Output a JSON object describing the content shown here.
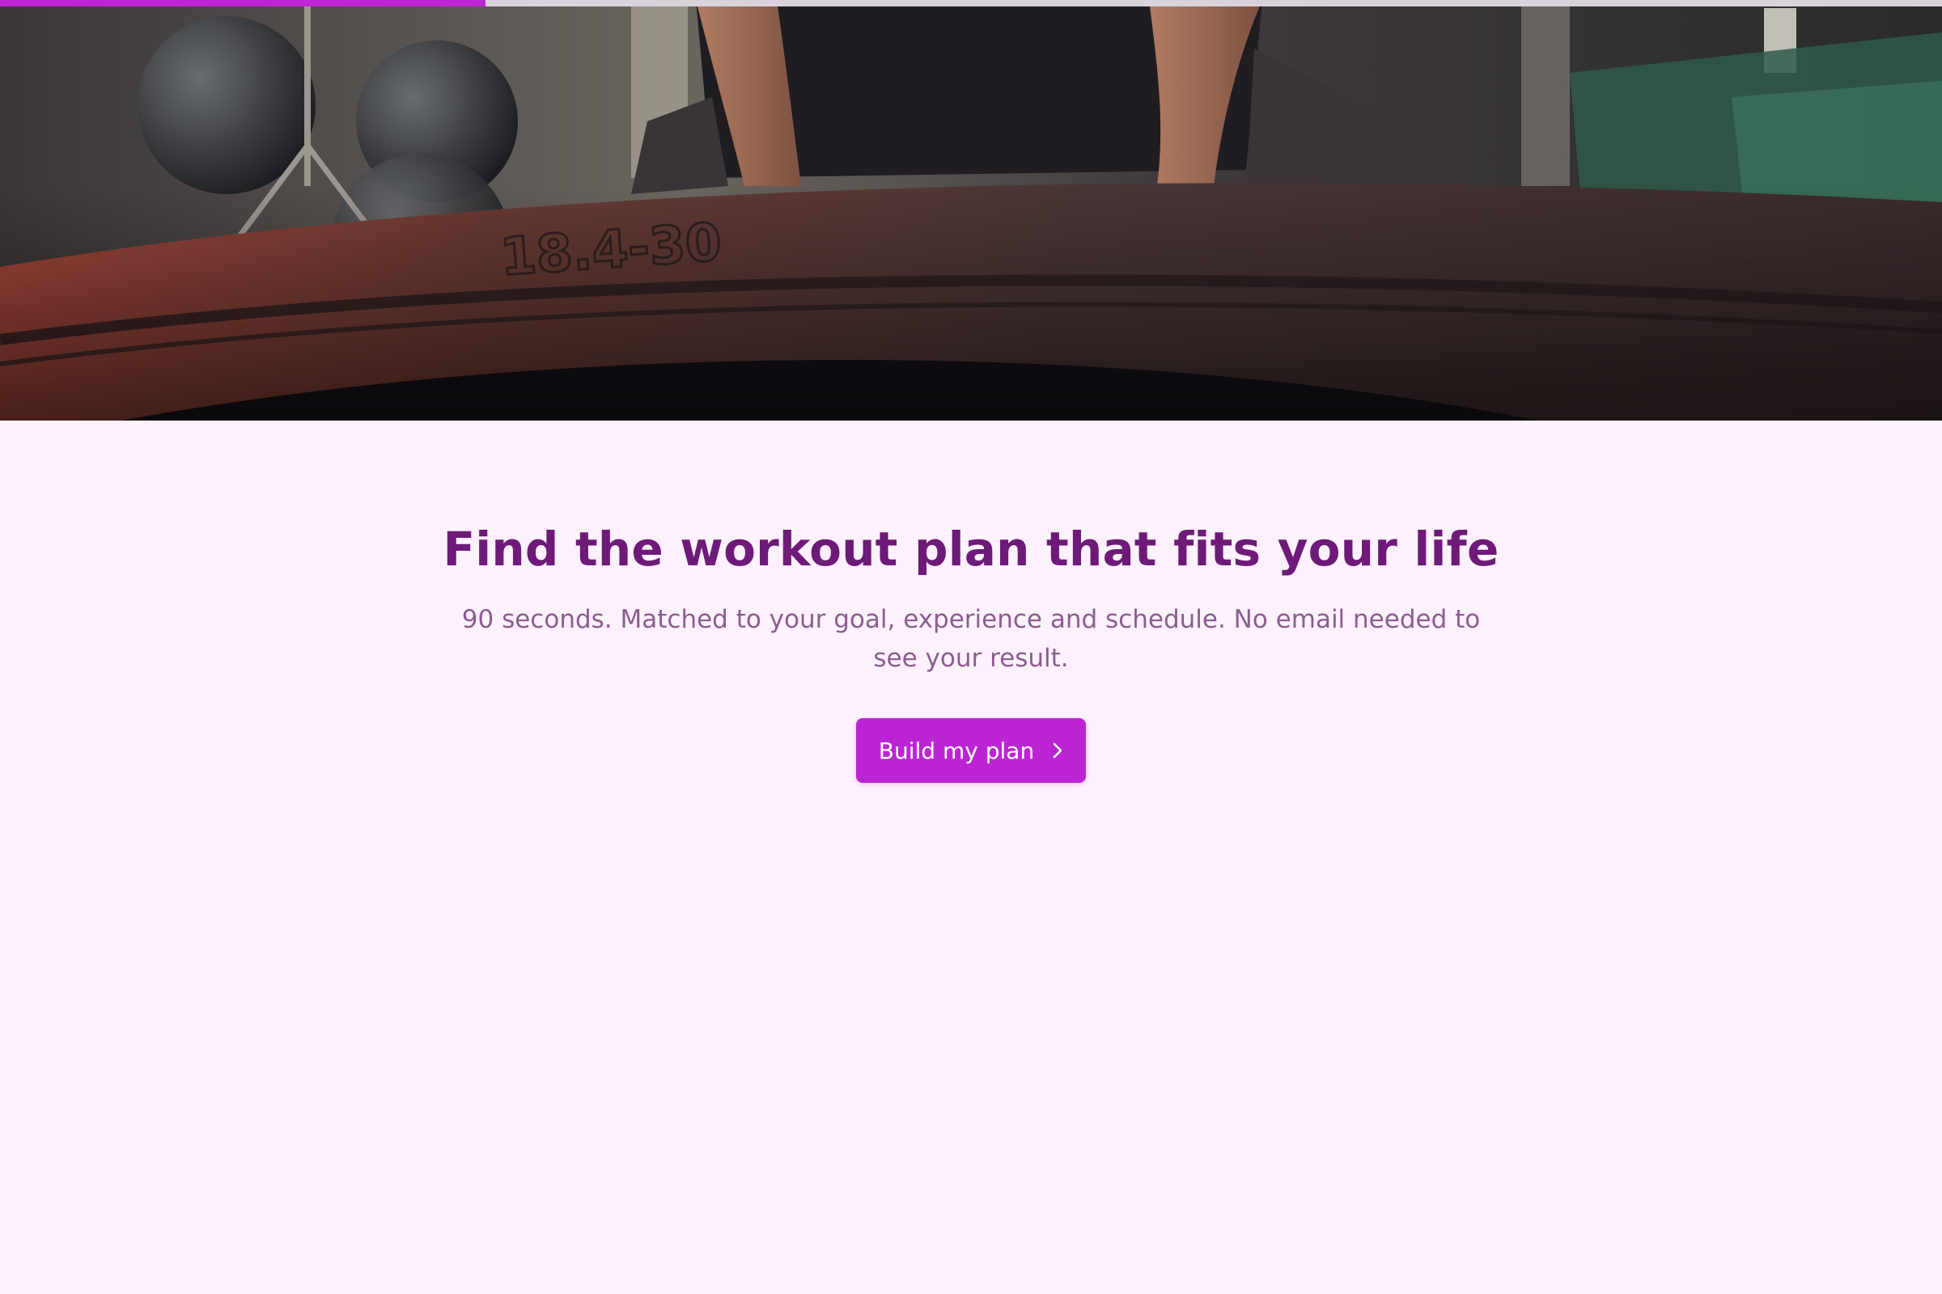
{
  "progress": {
    "fraction": 0.25,
    "fill_color": "#bf25d6",
    "track_color": "#d9d2da"
  },
  "hero": {
    "image_description_icon": "hero-photo-icon",
    "tire_printed_text": "18.4-30"
  },
  "main": {
    "headline": "Find the workout plan that fits your life",
    "subtitle": "90 seconds. Matched to your goal, experience and schedule. No email needed to see your result.",
    "cta_label": "Build my plan",
    "cta_icon": "chevron-right-icon"
  },
  "colors": {
    "page_background": "#fef1fe",
    "headline": "#6e1a78",
    "subtitle": "#8b5d8f",
    "accent": "#bc25d4"
  }
}
